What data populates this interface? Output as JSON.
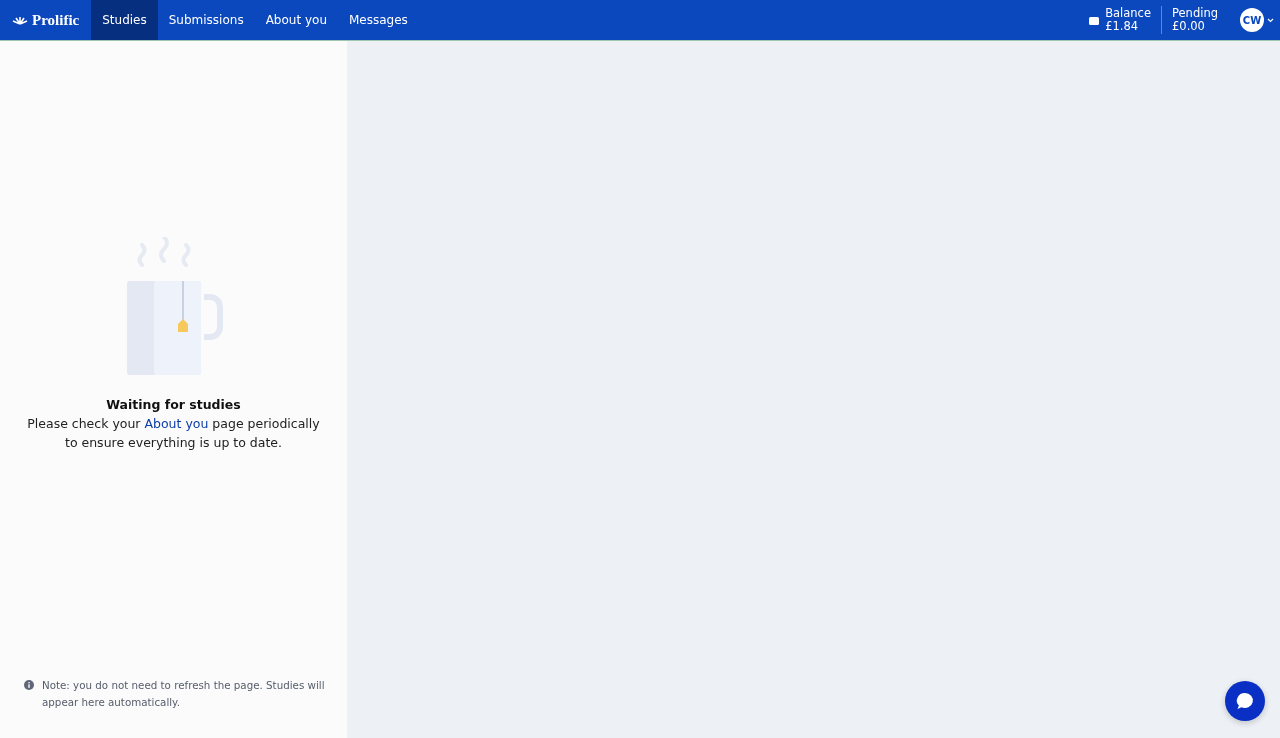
{
  "nav": {
    "logo": "Prolific",
    "tabs": [
      {
        "label": "Studies",
        "selected": true
      },
      {
        "label": "Submissions",
        "selected": false
      },
      {
        "label": "About you",
        "selected": false
      },
      {
        "label": "Messages",
        "selected": false
      }
    ],
    "balance": {
      "label": "Balance",
      "value": "£1.84"
    },
    "pending": {
      "label": "Pending",
      "value": "£0.00"
    },
    "avatar": "CW"
  },
  "empty_state": {
    "title": "Waiting for studies",
    "text_before": "Please check your ",
    "link": "About you",
    "text_after": " page periodically to ensure everything is up to date."
  },
  "note": "Note: you do not need to refresh the page. Studies will appear here automatically."
}
